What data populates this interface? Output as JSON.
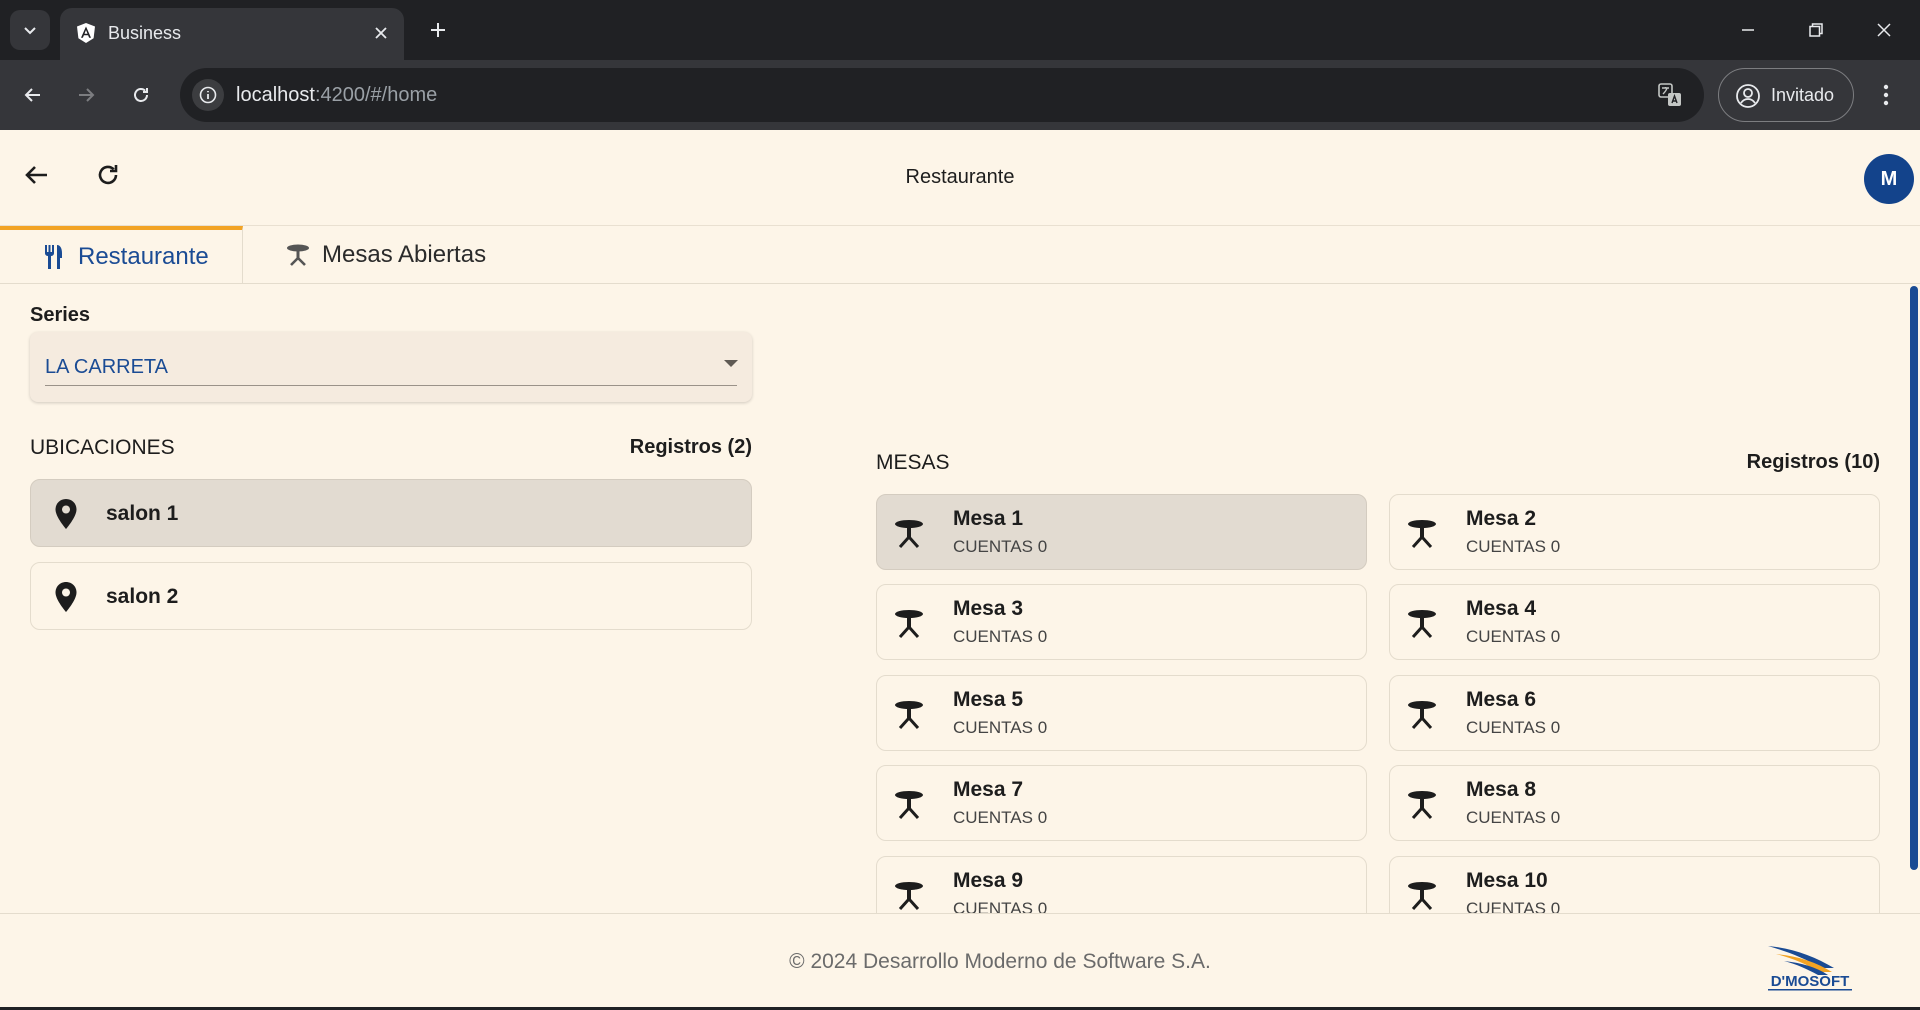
{
  "browser": {
    "tab_title": "Business",
    "url_host": "localhost",
    "url_rest": ":4200/#/home",
    "profile_label": "Invitado"
  },
  "header": {
    "title": "Restaurante",
    "avatar_initial": "M"
  },
  "tabs": [
    {
      "label": "Restaurante",
      "icon": "utensils-icon",
      "active": true
    },
    {
      "label": "Mesas Abiertas",
      "icon": "table-icon",
      "active": false
    }
  ],
  "series": {
    "label": "Series",
    "value": "LA CARRETA"
  },
  "ubicaciones": {
    "title": "UBICACIONES",
    "count_label": "Registros (2)",
    "items": [
      {
        "label": "salon 1",
        "selected": true
      },
      {
        "label": "salon 2",
        "selected": false
      }
    ]
  },
  "mesas": {
    "title": "MESAS",
    "count_label": "Registros (10)",
    "items": [
      {
        "name": "Mesa 1",
        "sub": "CUENTAS 0",
        "selected": true
      },
      {
        "name": "Mesa 2",
        "sub": "CUENTAS 0",
        "selected": false
      },
      {
        "name": "Mesa 3",
        "sub": "CUENTAS 0",
        "selected": false
      },
      {
        "name": "Mesa 4",
        "sub": "CUENTAS 0",
        "selected": false
      },
      {
        "name": "Mesa 5",
        "sub": "CUENTAS 0",
        "selected": false
      },
      {
        "name": "Mesa 6",
        "sub": "CUENTAS 0",
        "selected": false
      },
      {
        "name": "Mesa 7",
        "sub": "CUENTAS 0",
        "selected": false
      },
      {
        "name": "Mesa 8",
        "sub": "CUENTAS 0",
        "selected": false
      },
      {
        "name": "Mesa 9",
        "sub": "CUENTAS 0",
        "selected": false
      },
      {
        "name": "Mesa 10",
        "sub": "CUENTAS 0",
        "selected": false
      }
    ]
  },
  "footer": {
    "copyright": "© 2024 Desarrollo Moderno de Software S.A.",
    "logo_text": "D'MOSOFT"
  },
  "colors": {
    "accent": "#1a4b94",
    "tab_indicator": "#f2a324",
    "background": "#fdf5e8",
    "selected_card": "#e2dbd1"
  }
}
